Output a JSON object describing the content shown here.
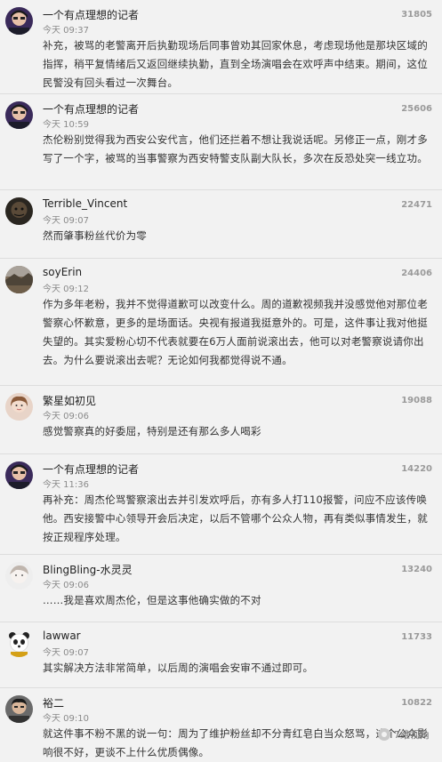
{
  "comments": [
    {
      "username": "一个有点理想的记者",
      "time": "今天 09:37",
      "likes": "31805",
      "text": "补充，被骂的老警离开后执勤现场后同事曾劝其回家休息，考虑现场他是那块区域的指挥，稍平复情绪后又返回继续执勤，直到全场演唱会在欢呼声中结束。期间，这位民警没有回头看过一次舞台。",
      "avatar": "journalist-avatar"
    },
    {
      "username": "一个有点理想的记者",
      "time": "今天 10:59",
      "likes": "25606",
      "text": "杰伦粉别觉得我为西安公安代言，他们还拦着不想让我说话呢。另修正一点，刚才多写了一个字，被骂的当事警察为西安特警支队副大队长，多次在反恐处突一线立功。",
      "avatar": "journalist-avatar"
    },
    {
      "username": "Terrible_Vincent",
      "time": "今天 09:07",
      "likes": "22471",
      "text": "然而肇事粉丝代价为零",
      "avatar": "dark-avatar"
    },
    {
      "username": "soyErin",
      "time": "今天 09:12",
      "likes": "24406",
      "text": "作为多年老粉，我并不觉得道歉可以改变什么。周的道歉视频我并没感觉他对那位老警察心怀歉意，更多的是场面话。央视有报道我挺意外的。可是，这件事让我对他挺失望的。其实爱粉心切不代表就要在6万人面前说滚出去，他可以对老警察说请你出去。为什么要说滚出去呢？无论如何我都觉得说不通。",
      "avatar": "landscape-avatar"
    },
    {
      "username": "繁星如初见",
      "time": "今天 09:06",
      "likes": "19088",
      "text": "感觉警察真的好委屈，特别是还有那么多人喝彩",
      "avatar": "girl-avatar"
    },
    {
      "username": "一个有点理想的记者",
      "time": "今天 11:36",
      "likes": "14220",
      "text": "再补充：周杰伦骂警察滚出去并引发欢呼后，亦有多人打110报警，问应不应该传唤他。西安接警中心领导开会后决定，以后不管哪个公众人物，再有类似事情发生，就按正规程序处理。",
      "avatar": "journalist-avatar"
    },
    {
      "username": "BlingBling-水灵灵",
      "time": "今天 09:06",
      "likes": "13240",
      "text": "……我是喜欢周杰伦，但是这事他确实做的不对",
      "avatar": "pale-avatar"
    },
    {
      "username": "lawwar",
      "time": "今天 09:07",
      "likes": "11733",
      "text": "其实解决方法非常简单，以后周的演唱会安审不通过即可。",
      "avatar": "panda-avatar"
    },
    {
      "username": "裕二",
      "time": "今天 09:10",
      "likes": "10822",
      "text": "就这件事不粉不黑的说一句：周为了维护粉丝却不分青红皂白当众怒骂，这个公众影响很不好，更谈不上什么优质偶像。",
      "avatar": "man-avatar"
    }
  ],
  "watermark": {
    "text": "7维视角",
    "icon": "wechat-icon"
  }
}
